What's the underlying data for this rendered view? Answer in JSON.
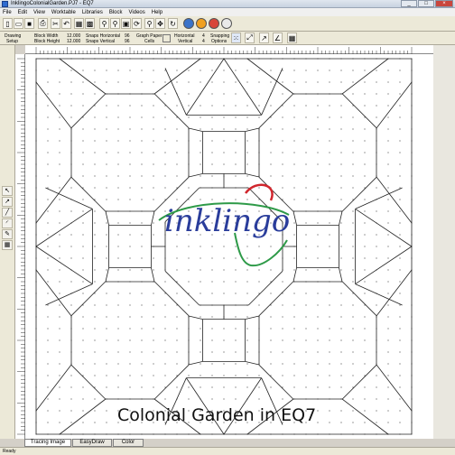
{
  "window": {
    "title": "InklingoColonialGarden.PJ7 - EQ7"
  },
  "menu": [
    "File",
    "Edit",
    "View",
    "Worktable",
    "Libraries",
    "Block",
    "Videos",
    "Help"
  ],
  "props": {
    "drawing": "Drawing",
    "setup": "Setup",
    "block_width_label": "Block Width",
    "block_width": "12.000",
    "block_height_label": "Block Height",
    "block_height": "12.000",
    "snaps_h_label": "Snaps Horizontal",
    "snaps_h": "96",
    "snaps_v_label": "Snaps Vertical",
    "snaps_v": "96",
    "graph_paper": "Graph Paper",
    "cells": "Cells",
    "horizontal_label": "Horizontal",
    "horizontal": "4",
    "vertical_label": "Vertical",
    "vertical": "4",
    "snapping": "Snapping",
    "options": "Options"
  },
  "logo": "inklingo",
  "caption": "Colonial Garden in EQ7",
  "tabs": [
    "Tracing Image",
    "EasyDraw",
    "Color"
  ],
  "status": "Ready",
  "colors": {
    "logo_blue": "#2a3d9b",
    "logo_green": "#2e9a48",
    "logo_red": "#d0262d"
  }
}
